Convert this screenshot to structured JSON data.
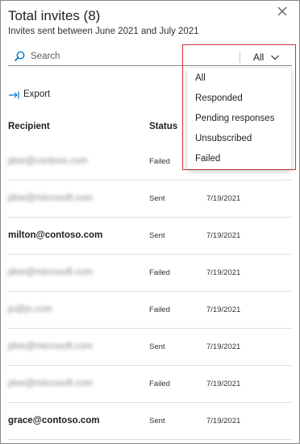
{
  "panel": {
    "title": "Total invites (8)",
    "subtitle": "Invites sent between June 2021 and July 2021"
  },
  "search": {
    "placeholder": "Search"
  },
  "filter": {
    "selected": "All",
    "options": [
      "All",
      "Responded",
      "Pending responses",
      "Unsubscribed",
      "Failed"
    ]
  },
  "toolbar": {
    "export_label": "Export"
  },
  "table": {
    "headers": {
      "recipient": "Recipient",
      "status": "Status"
    },
    "rows": [
      {
        "recipient": "jdoe@contoso.com",
        "status": "Failed",
        "date": ""
      },
      {
        "recipient": "jdoe@microsoft.com",
        "status": "Sent",
        "date": "7/19/2021"
      },
      {
        "recipient": "milton@contoso.com",
        "status": "Sent",
        "date": "7/19/2021"
      },
      {
        "recipient": "jdoe@microsoft.com",
        "status": "Failed",
        "date": "7/19/2021"
      },
      {
        "recipient": "jo@jo.com",
        "status": "Failed",
        "date": "7/19/2021"
      },
      {
        "recipient": "jdoe@microsoft.com",
        "status": "Sent",
        "date": "7/19/2021"
      },
      {
        "recipient": "jdoe@microsoft.com",
        "status": "Failed",
        "date": "7/19/2021"
      },
      {
        "recipient": "grace@contoso.com",
        "status": "Sent",
        "date": "7/19/2021"
      }
    ]
  },
  "icons": {
    "close": "close-icon",
    "search": "search-icon",
    "chevron": "chevron-down-icon",
    "export": "export-icon"
  },
  "colors": {
    "accent": "#0078d4",
    "highlight_border": "#d13438"
  }
}
